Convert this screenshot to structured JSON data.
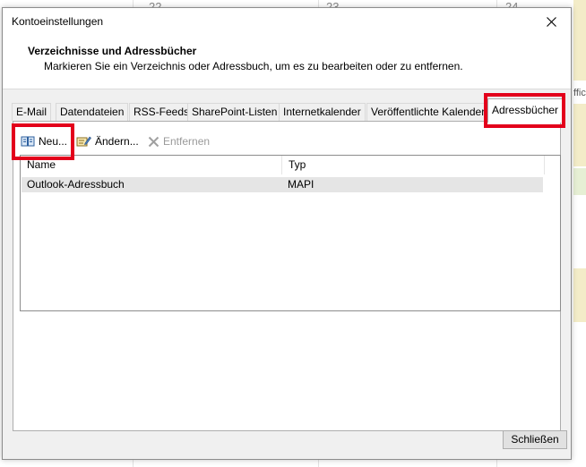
{
  "background_calendar": {
    "day_numbers": [
      "22",
      "23",
      "24"
    ],
    "partial_label": "ffic"
  },
  "dialog": {
    "title": "Kontoeinstellungen",
    "section_title": "Verzeichnisse und Adressbücher",
    "section_description": "Markieren Sie ein Verzeichnis oder Adressbuch, um es zu bearbeiten oder zu entfernen.",
    "tabs": [
      {
        "label": "E-Mail"
      },
      {
        "label": "Datendateien"
      },
      {
        "label": "RSS-Feeds"
      },
      {
        "label": "SharePoint-Listen"
      },
      {
        "label": "Internetkalender"
      },
      {
        "label": "Veröffentlichte Kalender"
      },
      {
        "label": "Adressbücher",
        "active": true
      }
    ],
    "toolbar": {
      "new_label": "Neu...",
      "change_label": "Ändern...",
      "remove_label": "Entfernen"
    },
    "table": {
      "columns": [
        "Name",
        "Typ"
      ],
      "rows": [
        {
          "name": "Outlook-Adressbuch",
          "type": "MAPI"
        }
      ]
    },
    "close_label": "Schließen"
  },
  "colors": {
    "highlight": "#e3001b",
    "dialog_bg": "#f0f0f0",
    "selected_row": "#e5e5e5"
  }
}
